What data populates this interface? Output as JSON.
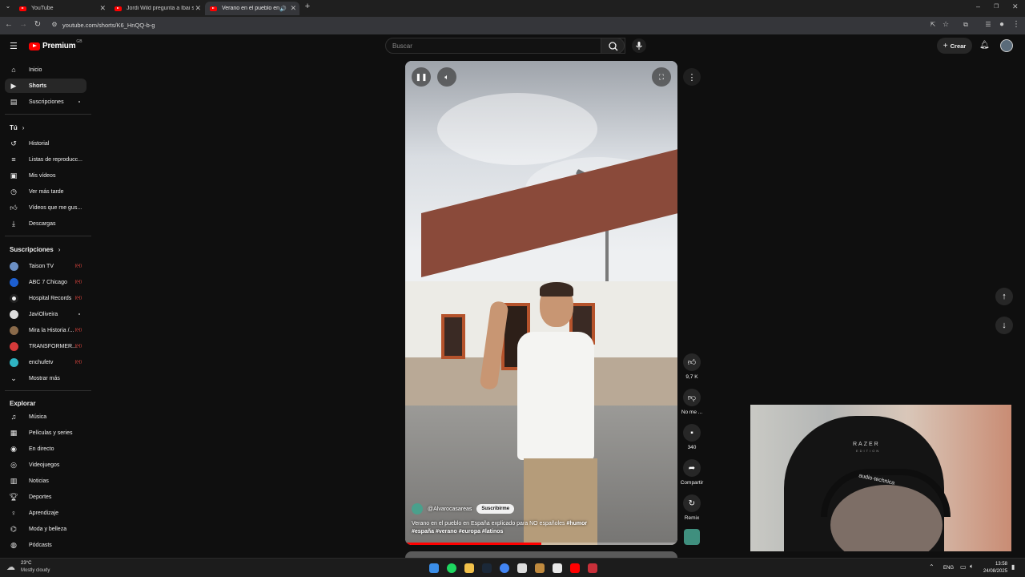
{
  "browser": {
    "tabs": [
      {
        "title": "YouTube"
      },
      {
        "title": "Jordi Wild pregunta a Ibai si es"
      },
      {
        "title": "Verano en el pueblo en Esp"
      }
    ],
    "url": "youtube.com/shorts/K6_HnQQ-b-g"
  },
  "header": {
    "logo_text": "Premium",
    "region": "GB",
    "search_placeholder": "Buscar",
    "create_label": "Crear"
  },
  "sidebar": {
    "main": [
      {
        "label": "Inicio",
        "icon": "home-icon"
      },
      {
        "label": "Shorts",
        "icon": "shorts-icon"
      },
      {
        "label": "Suscripciones",
        "icon": "subscriptions-icon"
      }
    ],
    "you_title": "Tú",
    "you": [
      {
        "label": "Historial",
        "icon": "history-icon"
      },
      {
        "label": "Listas de reproducc...",
        "icon": "playlist-icon"
      },
      {
        "label": "Mis vídeos",
        "icon": "my-videos-icon"
      },
      {
        "label": "Ver más tarde",
        "icon": "watch-later-icon"
      },
      {
        "label": "Vídeos que me gus...",
        "icon": "thumbs-up-icon"
      },
      {
        "label": "Descargas",
        "icon": "download-icon"
      }
    ],
    "subs_title": "Suscripciones",
    "subs": [
      {
        "label": "Taison TV",
        "color": "#6b8fc4"
      },
      {
        "label": "ABC 7 Chicago",
        "color": "#1d5fd1"
      },
      {
        "label": "Hospital Records",
        "color": "#222222"
      },
      {
        "label": "JaviOliveira",
        "color": "#dddddd"
      },
      {
        "label": "Mira la Historia /...",
        "color": "#8a6a4a"
      },
      {
        "label": "TRANSFORMER...",
        "color": "#d53a3a"
      },
      {
        "label": "enchufetv",
        "color": "#2fb3c2"
      }
    ],
    "show_more": "Mostrar más",
    "explore_title": "Explorar",
    "explore": [
      {
        "label": "Música",
        "icon": "music-icon"
      },
      {
        "label": "Películas y series",
        "icon": "film-icon"
      },
      {
        "label": "En directo",
        "icon": "live-icon"
      },
      {
        "label": "Videojuegos",
        "icon": "gaming-icon"
      },
      {
        "label": "Noticias",
        "icon": "news-icon"
      },
      {
        "label": "Deportes",
        "icon": "sports-icon"
      },
      {
        "label": "Aprendizaje",
        "icon": "learning-icon"
      },
      {
        "label": "Moda y belleza",
        "icon": "fashion-icon"
      },
      {
        "label": "Pódcasts",
        "icon": "podcast-icon"
      }
    ]
  },
  "short": {
    "channel": "@Alvarocasareas",
    "subscribe_label": "Suscribirme",
    "caption_text": "Verano en el pueblo en España explicado para NO españoles ",
    "caption_tag1": "#humor",
    "caption_tags": "#españa #verano #europa #latinos",
    "progress": 0.5
  },
  "actions": {
    "likes": "9,7 K",
    "dislike": "No me ...",
    "comments": "340",
    "share": "Compartir",
    "remix": "Remix"
  },
  "webcam": {
    "chair_brand": "RAZER",
    "chair_sub": "EDITION",
    "headset_brand": "audio-technica"
  },
  "taskbar": {
    "temperature": "23°C",
    "condition": "Mostly cloudy",
    "language": "ENG",
    "time": "13:58",
    "date": "24/08/2025"
  }
}
